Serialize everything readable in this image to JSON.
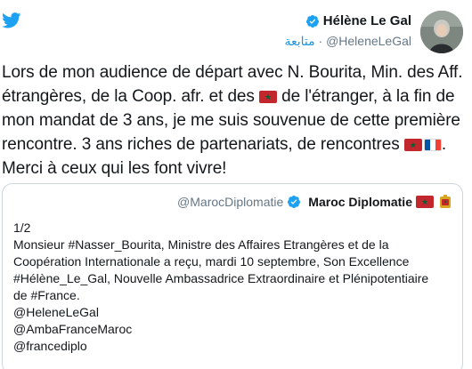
{
  "author": {
    "display_name": "Hélène Le Gal",
    "handle": "@HeleneLeGal",
    "follow_label": "متابعة",
    "separator": "·"
  },
  "tweet": {
    "seg1": "Lors de mon audience de départ avec N. Bourita, Min. des Aff. étrangères, de la Coop. afr. et des ",
    "seg2": " de l'étranger, à la fin de mon mandat de 3 ans, je me suis souvenue de cette première rencontre. 3 ans riches de partenariats, de rencontres ",
    "seg3": ". Merci à ceux qui les font vivre!",
    "flags": [
      "flag-ma",
      "flag-ma",
      "flag-fr"
    ]
  },
  "quoted": {
    "handle": "@MarocDiplomatie",
    "display_name": "Maroc Diplomatie",
    "lines": [
      "1/2",
      "Monsieur #Nasser_Bourita, Ministre des Affaires Etrangères et de la",
      "Coopération Internationale a reçu, mardi 10 septembre, Son Excellence",
      "#Hélène_Le_Gal, Nouvelle Ambassadrice Extraordinaire et Plénipotentiaire",
      "de #France.",
      "@HeleneLeGal",
      "@AmbaFranceMaroc",
      "@francediplo"
    ]
  },
  "colors": {
    "twitter_blue": "#1da1f2",
    "link_blue": "#1b95e0",
    "muted": "#657786",
    "border": "#ccd6dd"
  }
}
